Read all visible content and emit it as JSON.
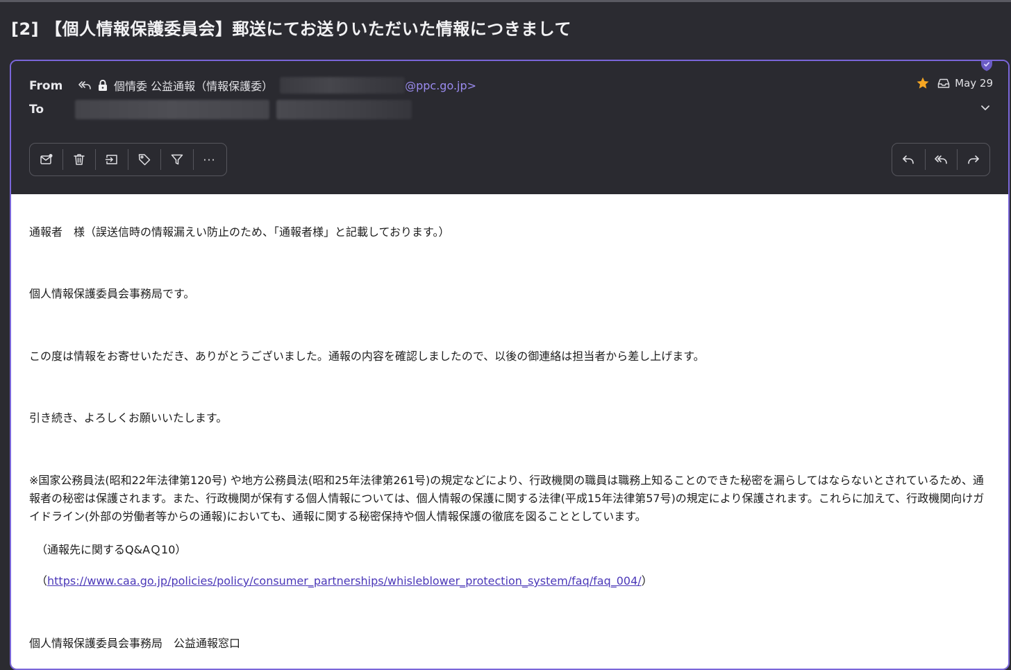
{
  "subject": "[2] 【個人情報保護委員会】郵送にてお送りいただいた情報につきまして",
  "header": {
    "from_label": "From",
    "to_label": "To",
    "sender_name": "個情委 公益通報（情報保護委）",
    "sender_domain": "@ppc.go.jp>",
    "date": "May 29"
  },
  "icons": {
    "sender_reply_all": "reply-all-icon",
    "sender_lock": "lock-icon",
    "starred": "star-icon",
    "folder": "inbox-icon",
    "expand": "chevron-down-icon",
    "verified": "shield-check-icon"
  },
  "toolbar": {
    "left": [
      "mark-unread-icon",
      "trash-icon",
      "move-icon",
      "tag-icon",
      "filter-icon",
      "more-icon"
    ],
    "right": [
      "reply-icon",
      "reply-all-icon",
      "forward-icon"
    ],
    "more_label": "···"
  },
  "body": {
    "p1": "通報者　様（誤送信時の情報漏えい防止のため、「通報者様」と記載しております。）",
    "p2": "個人情報保護委員会事務局です。",
    "p3": "この度は情報をお寄せいただき、ありがとうございました。通報の内容を確認しましたので、以後の御連絡は担当者から差し上げます。",
    "p4": "引き続き、よろしくお願いいたします。",
    "p5": "※国家公務員法(昭和22年法律第120号) や地方公務員法(昭和25年法律第261号)の規定などにより、行政機関の職員は職務上知ることのできた秘密を漏らしてはならないとされているため、通報者の秘密は保護されます。また、行政機関が保有する個人情報については、個人情報の保護に関する法律(平成15年法律第57号)の規定により保護されます。これらに加えて、行政機関向けガイドライン(外部の労働者等からの通報)においても、通報に関する秘密保持や個人情報保護の徹底を図ることとしています。",
    "p6": "（通報先に関するQ&AＱ10）",
    "link_open": "（",
    "link": "https://www.caa.go.jp/policies/policy/consumer_partnerships/whisleblower_protection_system/faq/faq_004/",
    "link_close": "）",
    "signature": "個人情報保護委員会事務局　公益通報窓口"
  },
  "colors": {
    "background": "#2b2b31",
    "accent_border": "#7a66d9",
    "link": "#4a37b8",
    "sender_domain": "#9b8cf0",
    "star": "#f5a623"
  }
}
